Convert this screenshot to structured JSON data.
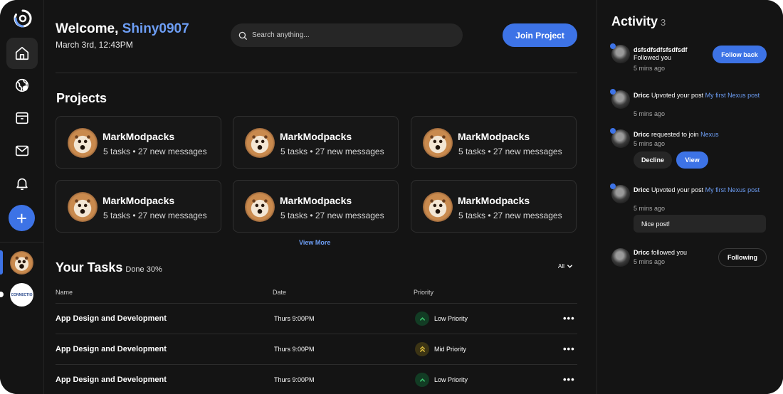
{
  "header": {
    "welcome_prefix": "Welcome,",
    "username": "Shiny0907",
    "datetime": "March 3rd, 12:43PM",
    "search_placeholder": "Search anything...",
    "join_label": "Join Project"
  },
  "sidebar": {
    "items": [
      {
        "name": "home",
        "icon": "home-icon",
        "active": true
      },
      {
        "name": "explore",
        "icon": "globe-icon",
        "active": false
      },
      {
        "name": "archive",
        "icon": "archive-icon",
        "active": false
      },
      {
        "name": "mail",
        "icon": "mail-icon",
        "active": false
      },
      {
        "name": "notifications",
        "icon": "bell-icon",
        "active": false
      }
    ],
    "add_label": "+",
    "workspace2_label": "CONNECTIO"
  },
  "projects": {
    "title": "Projects",
    "cards": [
      {
        "name": "MarkModpacks",
        "meta": "5 tasks • 27 new messages"
      },
      {
        "name": "MarkModpacks",
        "meta": "5 tasks • 27 new messages"
      },
      {
        "name": "MarkModpacks",
        "meta": "5 tasks • 27 new messages"
      },
      {
        "name": "MarkModpacks",
        "meta": "5 tasks • 27 new messages"
      },
      {
        "name": "MarkModpacks",
        "meta": "5 tasks • 27 new messages"
      },
      {
        "name": "MarkModpacks",
        "meta": "5 tasks • 27 new messages"
      }
    ],
    "view_more": "View More"
  },
  "tasks": {
    "title": "Your Tasks",
    "done": "Done 30%",
    "filter": "All",
    "columns": {
      "name": "Name",
      "date": "Date",
      "priority": "Priority"
    },
    "rows": [
      {
        "name": "App Design and Development",
        "date": "Thurs 9:00PM",
        "priority": "Low Priority",
        "level": "low"
      },
      {
        "name": "App Design and Development",
        "date": "Thurs 9:00PM",
        "priority": "Mid Priority",
        "level": "mid"
      },
      {
        "name": "App Design and Development",
        "date": "Thurs 9:00PM",
        "priority": "Low Priority",
        "level": "low"
      }
    ]
  },
  "activity": {
    "title": "Activity",
    "count": "3",
    "items": [
      {
        "user": "dsfsdfsdfsfsdfsdf",
        "text": "Followed you",
        "time": "5 mins ago",
        "action": "Follow back"
      },
      {
        "user": "Dricc",
        "text": "Upvoted your post",
        "link": "My first Nexus post",
        "time": "5 mins ago"
      },
      {
        "user": "Dricc",
        "text": "requested to join",
        "link": "Nexus",
        "time": "5 mins ago",
        "decline": "Decline",
        "view": "View"
      },
      {
        "user": "Dricc",
        "text": "Upvoted your post",
        "link": "My first Nexus post",
        "time": "5 mins ago",
        "reply": "Nice post!"
      },
      {
        "user": "Dricc",
        "text": "followed you",
        "time": "5 mins ago",
        "action": "Following"
      }
    ]
  },
  "colors": {
    "background": "#141414",
    "accent": "#3d73e6",
    "link": "#6d9ef5",
    "low_priority": "#2fa35a",
    "mid_priority": "#d9b93a"
  }
}
